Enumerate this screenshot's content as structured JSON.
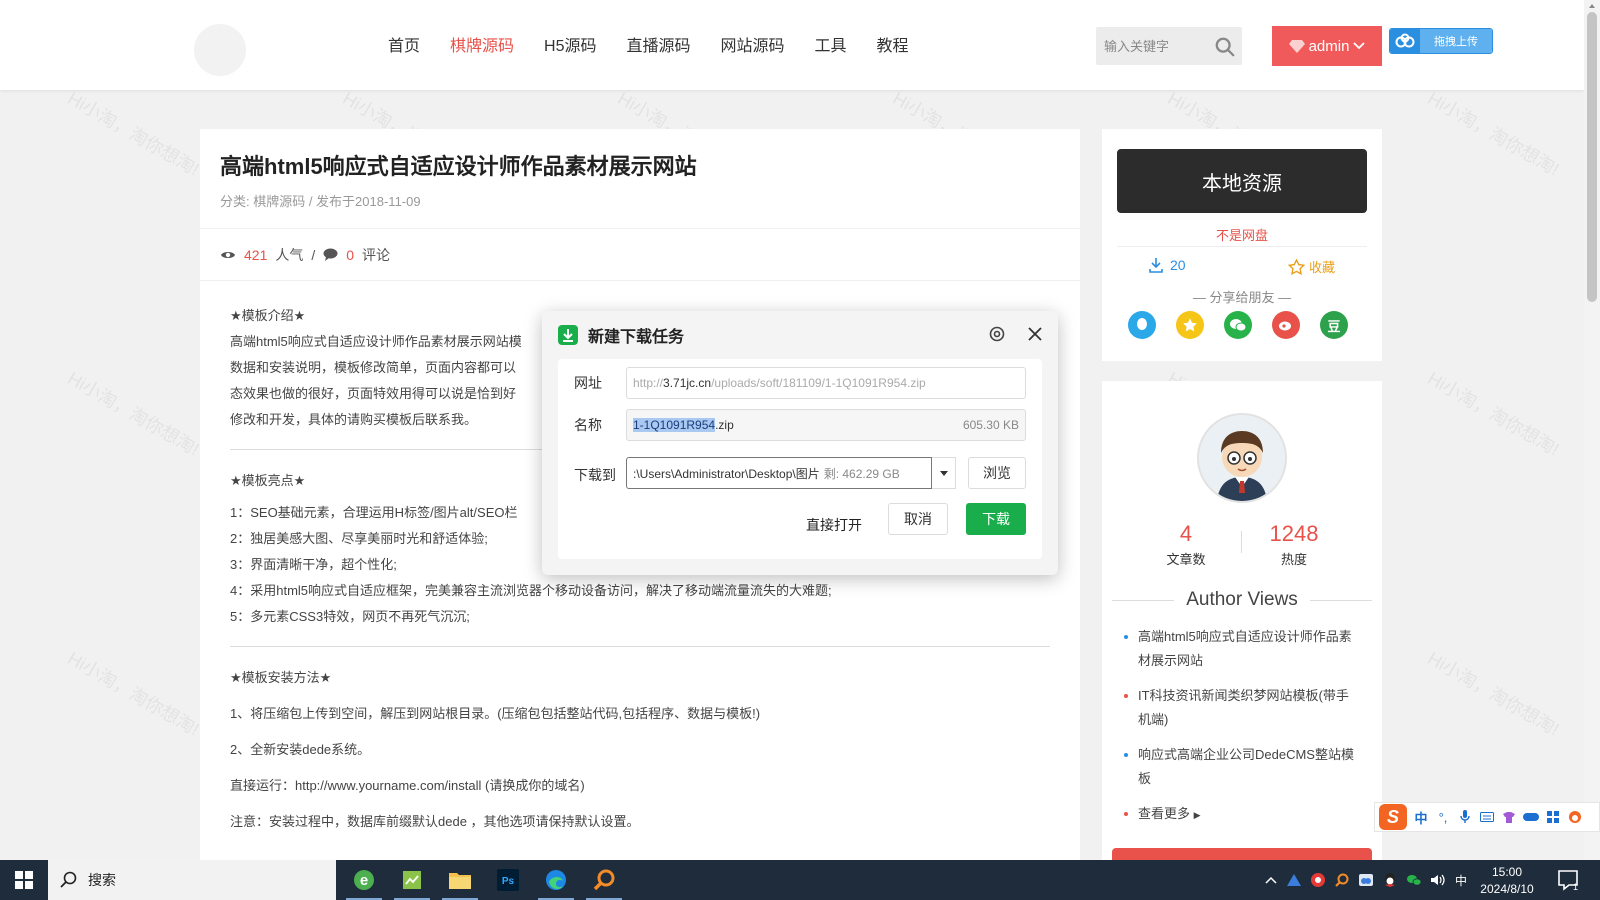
{
  "nav": {
    "items": [
      "首页",
      "棋牌源码",
      "H5源码",
      "直播源码",
      "网站源码",
      "工具",
      "教程"
    ],
    "active_index": 1
  },
  "search": {
    "placeholder": "输入关键字"
  },
  "user": {
    "name": "admin"
  },
  "upload": {
    "label": "拖拽上传"
  },
  "watermark": "Hi小淘，淘你想淘!",
  "article": {
    "title": "高端html5响应式自适应设计师作品素材展示网站",
    "meta": "分类: 棋牌源码 / 发布于2018-11-09",
    "views": "421",
    "views_label": "人气",
    "comments": "0",
    "comments_label": "评论",
    "intro_title": "★模板介绍★",
    "intro_lines": [
      "高端html5响应式自适应设计师作品素材展示网站模",
      "数据和安装说明，模板修改简单，页面内容都可以",
      "态效果也做的很好，页面特效用得可以说是恰到好",
      "修改和开发，具体的请购买模板后联系我。"
    ],
    "highlights_title": "★模板亮点★",
    "highlights": [
      "1：SEO基础元素，合理运用H标签/图片alt/SEO栏",
      "2：独居美感大图、尽享美丽时光和舒适体验;",
      "3：界面清晰干净，超个性化;",
      "4：采用html5响应式自适应框架，完美兼容主流浏览器个移动设备访问，解决了移动端流量流失的大难题;",
      "5：多元素CSS3特效，网页不再死气沉沉;"
    ],
    "install_title": "★模板安装方法★",
    "install_steps": [
      "1、将压缩包上传到空间，解压到网站根目录。(压缩包包括整站代码,包括程序、数据与模板!)",
      "2、全新安装dede系统。",
      "直接运行：http://www.yourname.com/install (请换成你的域名)",
      "注意：安装过程中，数据库前缀默认dede ，其他选项请保持默认设置。"
    ]
  },
  "sidebar": {
    "local_resource": "本地资源",
    "not_netdisk": "不是网盘",
    "download_count": "20",
    "favorite": "收藏",
    "share_title": "— 分享给朋友 —",
    "share_douban": "豆",
    "author_articles": "4",
    "author_articles_label": "文章数",
    "author_heat": "1248",
    "author_heat_label": "热度",
    "views_title": "Author Views",
    "views_list": [
      "高端html5响应式自适应设计师作品素材展示网站",
      "IT科技资讯新闻类织梦网站模板(带手机端)",
      "响应式高端企业公司DedeCMS整站模板",
      "查看更多"
    ],
    "views_dot_colors": [
      "#2a8fe0",
      "#e8524a",
      "#2a8fe0",
      "#e8524a"
    ]
  },
  "dialog": {
    "title": "新建下载任务",
    "url_label": "网址",
    "url_prefix": "http://",
    "url_host": "3.71jc.cn",
    "url_path": "/uploads/soft/181109/1-1Q1091R954.zip",
    "name_label": "名称",
    "name_selected": "1-1Q1091R954",
    "name_ext": ".zip",
    "name_size": "605.30 KB",
    "save_label": "下载到",
    "save_path": ":\\Users\\Administrator\\Desktop\\图片",
    "free_space": "剩: 462.29 GB",
    "browse": "浏览",
    "open_direct": "直接打开",
    "cancel": "取消",
    "download": "下载"
  },
  "ime": {
    "lang": "中"
  },
  "taskbar": {
    "search_label": "搜索",
    "tray_lang": "中",
    "time": "15:00",
    "date": "2024/8/10"
  },
  "colors": {
    "accent_red": "#e8524a",
    "download_green": "#1aad4b",
    "link_blue": "#2a8fe0"
  }
}
